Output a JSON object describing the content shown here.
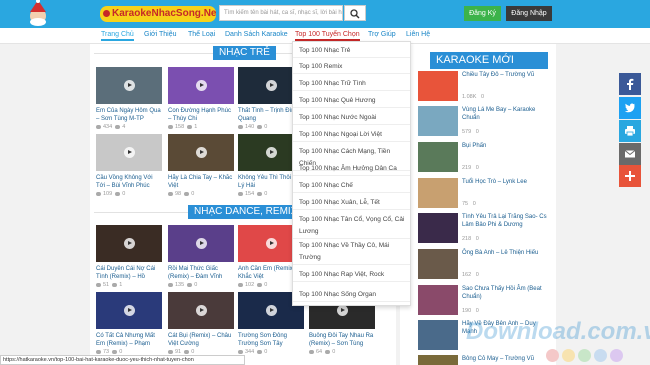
{
  "header": {
    "logo_text": "KaraokeNhacSong.Net",
    "search_placeholder": "Tìm kiếm tên bài hát, ca sĩ, nhạc sĩ, lời bài hát",
    "register_label": "Đăng Ký",
    "login_label": "Đăng Nhập"
  },
  "nav": {
    "items": [
      "Trang Chủ",
      "Giới Thiệu",
      "Thể Loại",
      "Danh Sách Karaoke",
      "Top 100 Tuyển Chọn",
      "Trợ Giúp",
      "Liên Hệ"
    ]
  },
  "dropdown": {
    "items": [
      "Top 100 Nhạc Trẻ",
      "Top 100 Remix",
      "Top 100 Nhạc Trữ Tình",
      "Top 100 Nhạc Quê Hương",
      "Top 100 Nhạc Nước Ngoài",
      "Top 100 Nhạc Ngoại Lời Việt",
      "Top 100 Nhạc Cách Mạng, Tiền Chiến",
      "Top 100 Nhạc Âm Hưởng Dân Ca",
      "Top 100 Nhạc Chế",
      "Top 100 Nhạc Xuân, Lễ, Tết",
      "Top 100 Nhạc Tân Cổ, Vọng Cổ, Cải Lương",
      "Top 100 Nhạc Về Thầy Cô, Mái Trường",
      "Top 100 Nhạc Rap Việt, Rock",
      "Top 100 Nhạc Sống Organ"
    ]
  },
  "sections": {
    "nhac_tre": {
      "title": "NHẠC TRẺ",
      "cards": [
        {
          "title": "Em Của Ngày Hôm Qua – Sơn Tùng M-TP",
          "views": "434",
          "likes": "4",
          "color": "#5b6e7a"
        },
        {
          "title": "Con Đường Hạnh Phúc – Thùy Chi",
          "views": "158",
          "likes": "1",
          "color": "#7b4fb0"
        },
        {
          "title": "Thất Tình – Trịnh Đình Quang",
          "views": "140",
          "likes": "0",
          "color": "#1e2b3a"
        },
        {
          "title": "Cầu Vồng Không Với Tới – Bùi Vĩnh Phúc",
          "views": "109",
          "likes": "0",
          "color": "#c8c8c8"
        },
        {
          "title": "Hãy Là Chia Tay – Khắc Việt",
          "views": "98",
          "likes": "0",
          "color": "#5a4a36"
        },
        {
          "title": "Không Yêu Thì Thôi – Lý Hải",
          "views": "154",
          "likes": "0",
          "color": "#2b3a22"
        }
      ]
    },
    "nhac_dance": {
      "title": "NHẠC DANCE, REMIX",
      "cards": [
        {
          "title": "Cái Duyên Cái Nợ Cái Tình (Remix) – Hồ",
          "views": "51",
          "likes": "1",
          "color": "#3a2c24"
        },
        {
          "title": "Rồi Mai Thức Giấc (Remix) – Đàm Vĩnh",
          "views": "135",
          "likes": "0",
          "color": "#5a3f8a"
        },
        {
          "title": "Anh Cần Em (Remix) – Khắc Việt",
          "views": "102",
          "likes": "0",
          "color": "#e04848"
        },
        {
          "title": "Có Tất Cả Nhưng Mất Em (Remix) – Phạm",
          "views": "73",
          "likes": "0",
          "color": "#2a3a7a"
        },
        {
          "title": "Cát Bụi (Remix) – Châu Việt Cường",
          "views": "91",
          "likes": "0",
          "color": "#4a3a3a"
        },
        {
          "title": "Trường Sơn Đông Trường Sơn Tây",
          "views": "344",
          "likes": "0",
          "color": "#1a2a4a"
        },
        {
          "title": "Buông Đôi Tay Nhau Ra (Remix) – Sơn Tùng",
          "views": "64",
          "likes": "0",
          "color": "#2a2a2a"
        }
      ]
    }
  },
  "karaoke_moi": {
    "title": "KARAOKE MỚI",
    "items": [
      {
        "title": "Chiều Tây Đô – Trường Vũ",
        "views": "1.08K",
        "likes": "0",
        "color": "#e8543a"
      },
      {
        "title": "Vùng Lá Me Bay – Karaoke Chuẩn",
        "views": "579",
        "likes": "0",
        "color": "#7aa8c0"
      },
      {
        "title": "Bụi Phấn",
        "views": "219",
        "likes": "0",
        "color": "#5a7a5a"
      },
      {
        "title": "Tuổi Học Trò – Lynk Lee",
        "views": "75",
        "likes": "0",
        "color": "#c8a070"
      },
      {
        "title": "Tình Yêu Trả Lại Trăng Sao- Cs Lâm Bảo Phi & Dương",
        "views": "218",
        "likes": "0",
        "color": "#3a2a4a"
      },
      {
        "title": "Ông Bà Anh – Lê Thiện Hiếu",
        "views": "162",
        "likes": "0",
        "color": "#6a5a4a"
      },
      {
        "title": "Sao Chưa Thấy Hồi Âm (Beat Chuẩn)",
        "views": "190",
        "likes": "0",
        "color": "#8a4a6a"
      },
      {
        "title": "Hãy Về Đây Bên Anh – Duy Mạnh",
        "views": "",
        "likes": "",
        "color": "#4a6a8a"
      },
      {
        "title": "Bông Cỏ May – Trường Vũ",
        "views": "",
        "likes": "",
        "color": "#7a6a3a"
      }
    ]
  },
  "statusbar": {
    "url": "https://hatkaraoke.vn/top-100-bai-hat-karaoke-duoc-yeu-thich-nhat-tuyen-chon"
  },
  "watermark": "Download.com.vn",
  "colors": {
    "header_bg": "#2aa7e0",
    "section_tab": "#2a8fd6",
    "register_btn": "#3cb34a",
    "login_btn": "#3a3a3a",
    "facebook": "#3b5998",
    "twitter": "#1da1f2",
    "print": "#2aa7e0",
    "email": "#6a6a6a",
    "plus": "#e8543a"
  },
  "social": [
    "facebook-icon",
    "twitter-icon",
    "print-icon",
    "email-icon",
    "plus-icon"
  ]
}
